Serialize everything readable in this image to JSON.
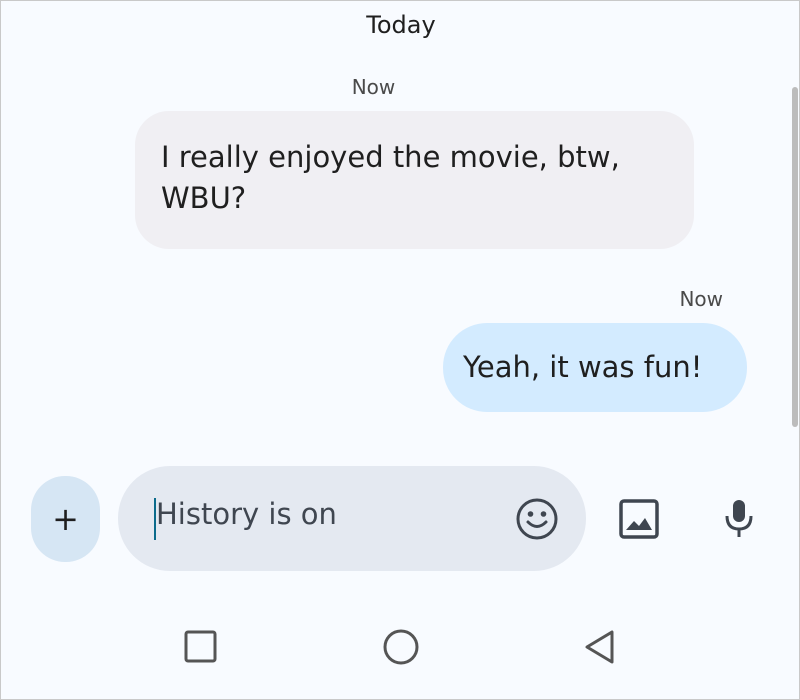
{
  "conversation": {
    "day_header": "Today",
    "messages": [
      {
        "direction": "incoming",
        "time": "Now",
        "text": "I really enjoyed the movie, btw, WBU?"
      },
      {
        "direction": "outgoing",
        "time": "Now",
        "text": "Yeah, it was fun!"
      }
    ]
  },
  "composer": {
    "placeholder": "History is on",
    "add_button_label": "+",
    "icons": [
      "plus-icon",
      "emoji-icon",
      "image-icon",
      "mic-icon"
    ]
  },
  "navigation_bar": {
    "icons": [
      "recents-square-icon",
      "home-circle-icon",
      "back-triangle-icon"
    ]
  },
  "colors": {
    "background": "#f8fbff",
    "incoming_bubble": "#f0eff3",
    "outgoing_bubble": "#d3ebff",
    "compose_field": "#e4e9f1",
    "add_button": "#d6e6f4",
    "caret": "#0b6b8c"
  }
}
